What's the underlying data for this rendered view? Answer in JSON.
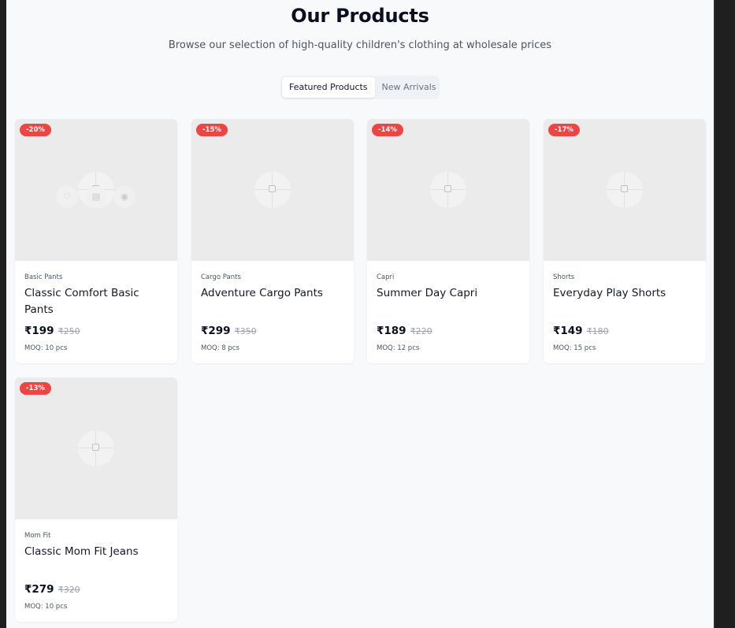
{
  "header": {
    "title": "Our Products",
    "subtitle": "Browse our selection of high-quality children's clothing at wholesale prices"
  },
  "tabs": [
    {
      "label": "Featured Products",
      "active": true
    },
    {
      "label": "New Arrivals",
      "active": false
    }
  ],
  "products": [
    {
      "discount": "-20%",
      "category": "Basic Pants",
      "name": "Classic Comfort Basic Pants",
      "price": "₹199",
      "original_price": "₹250",
      "moq": "MOQ: 10 pcs"
    },
    {
      "discount": "-15%",
      "category": "Cargo Pants",
      "name": "Adventure Cargo Pants",
      "price": "₹299",
      "original_price": "₹350",
      "moq": "MOQ: 8 pcs"
    },
    {
      "discount": "-14%",
      "category": "Capri",
      "name": "Summer Day Capri",
      "price": "₹189",
      "original_price": "₹220",
      "moq": "MOQ: 12 pcs"
    },
    {
      "discount": "-17%",
      "category": "Shorts",
      "name": "Everyday Play Shorts",
      "price": "₹149",
      "original_price": "₹180",
      "moq": "MOQ: 15 pcs"
    },
    {
      "discount": "-13%",
      "category": "Mom Fit",
      "name": "Classic Mom Fit Jeans",
      "price": "₹279",
      "original_price": "₹320",
      "moq": "MOQ: 10 pcs"
    }
  ],
  "hover_actions": {
    "wishlist_icon": "♡",
    "cart_icon": "▤",
    "view_icon": "◉"
  },
  "colors": {
    "badge": "#ef4444",
    "page_background": "#f8f9fb",
    "image_placeholder": "#ebebeb"
  }
}
